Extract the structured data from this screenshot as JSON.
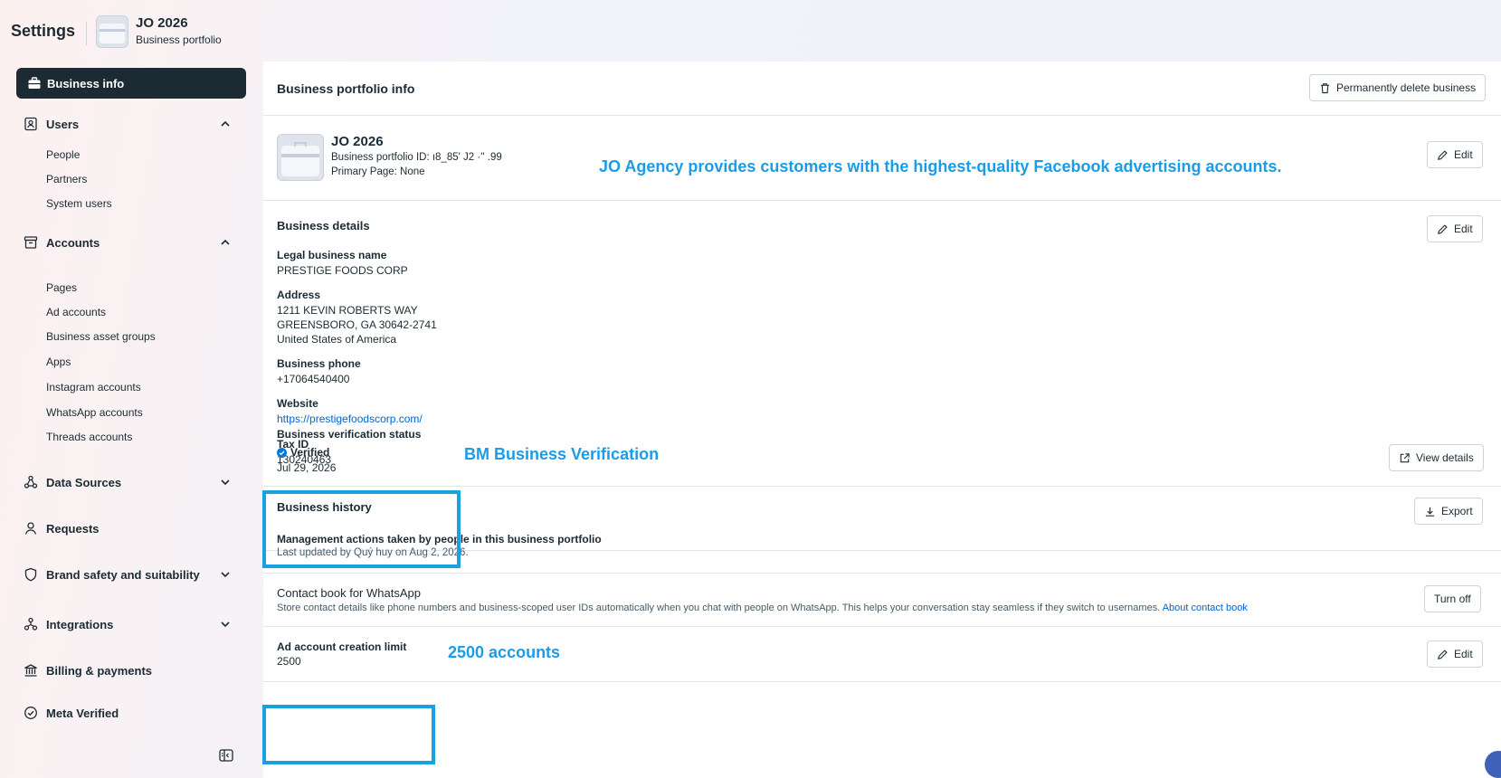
{
  "header": {
    "settings_title": "Settings",
    "portfolio_name": "JO 2026",
    "portfolio_sub": "Business portfolio"
  },
  "sidebar": {
    "active": {
      "label": "Business info",
      "icon": "briefcase-icon"
    },
    "users": {
      "label": "Users",
      "icon": "contact-card-icon",
      "items": [
        "People",
        "Partners",
        "System users"
      ]
    },
    "accounts": {
      "label": "Accounts",
      "icon": "archive-box-icon",
      "items": [
        "Pages",
        "Ad accounts",
        "Business asset groups",
        "Apps",
        "Instagram accounts",
        "WhatsApp accounts",
        "Threads accounts"
      ]
    },
    "data_sources": {
      "label": "Data Sources",
      "icon": "data-sources-icon"
    },
    "requests": {
      "label": "Requests",
      "icon": "person-icon"
    },
    "brand_safety": {
      "label": "Brand safety and suitability",
      "icon": "shield-icon"
    },
    "integrations": {
      "label": "Integrations",
      "icon": "integrations-icon"
    },
    "billing": {
      "label": "Billing & payments",
      "icon": "bank-icon"
    },
    "meta_verified": {
      "label": "Meta Verified",
      "icon": "verified-badge-icon"
    }
  },
  "main": {
    "title": "Business portfolio info",
    "delete_button": "Permanently delete business",
    "profile": {
      "name": "JO 2026",
      "id_line": "Business portfolio ID: ı8_85' J2 ·'' .99",
      "primary_page": "Primary Page: None",
      "edit": "Edit"
    },
    "promo_annotation": "JO Agency provides customers with the highest-quality Facebook advertising accounts.",
    "details": {
      "title": "Business details",
      "edit": "Edit",
      "legal_name_label": "Legal business name",
      "legal_name": "PRESTIGE FOODS CORP",
      "address_label": "Address",
      "address_line1": "1211 KEVIN ROBERTS WAY",
      "address_line2": "GREENSBORO, GA 30642-2741",
      "address_line3": "United States of America",
      "phone_label": "Business phone",
      "phone": "+17064540400",
      "website_label": "Website",
      "website": "https://prestigefoodscorp.com/",
      "tax_label": "Tax ID",
      "tax_id": "130240463"
    },
    "verification": {
      "title": "Business verification status",
      "status": "Verified",
      "date": "Jul 29, 2026",
      "button": "View details",
      "annotation": "BM Business Verification"
    },
    "history": {
      "title": "Business history",
      "export": "Export",
      "subtitle": "Management actions taken by people in this business portfolio",
      "updated": "Last updated by Quý huy on Aug 2, 2026."
    },
    "contact_book": {
      "title": "Contact book for WhatsApp",
      "description": "Store contact details like phone numbers and business-scoped user IDs automatically when you chat with people on WhatsApp. This helps your conversation stay seamless if they switch to usernames.",
      "link": "About contact book",
      "button": "Turn off"
    },
    "ad_limit": {
      "title": "Ad account creation limit",
      "value": "2500",
      "edit": "Edit",
      "annotation": "2500 accounts"
    }
  },
  "colors": {
    "nav_active_bg": "#1c2b33",
    "link": "#0064d1",
    "annotation": "#1a9ce6",
    "highlight_box": "#1aa1e3",
    "verified": "#0a78d1"
  }
}
